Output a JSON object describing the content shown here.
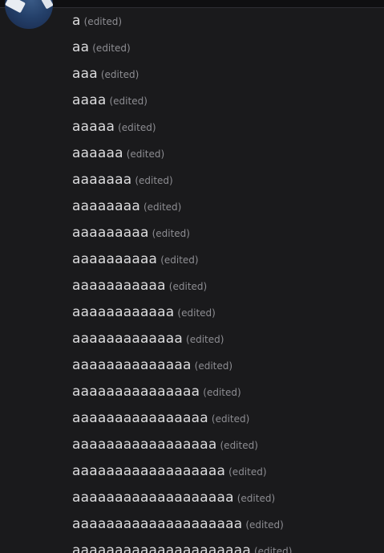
{
  "chat": {
    "edited_label": "(edited)",
    "messages": [
      "a",
      "aa",
      "aaa",
      "aaaa",
      "aaaaa",
      "aaaaaa",
      "aaaaaaa",
      "aaaaaaaa",
      "aaaaaaaaa",
      "aaaaaaaaaa",
      "aaaaaaaaaaa",
      "aaaaaaaaaaaa",
      "aaaaaaaaaaaaa",
      "aaaaaaaaaaaaaa",
      "aaaaaaaaaaaaaaa",
      "aaaaaaaaaaaaaaaa",
      "aaaaaaaaaaaaaaaaa",
      "aaaaaaaaaaaaaaaaaa",
      "aaaaaaaaaaaaaaaaaaa",
      "aaaaaaaaaaaaaaaaaaaa",
      "aaaaaaaaaaaaaaaaaaaaa"
    ]
  }
}
